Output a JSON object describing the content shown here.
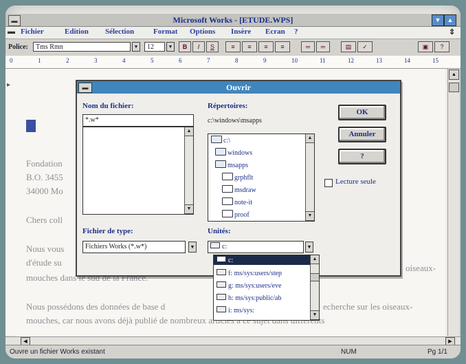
{
  "window": {
    "title": "Microsoft Works - [ETUDE.WPS]"
  },
  "menu": [
    "Fichier",
    "Edition",
    "Sélection",
    "Format",
    "Options",
    "Insère",
    "Ecran",
    "?"
  ],
  "toolbar": {
    "font_label": "Police:",
    "font_value": "Tms Rmn",
    "size_value": "12",
    "bold": "B",
    "italic": "I",
    "underline": "S"
  },
  "ruler": [
    "0",
    "1",
    "2",
    "3",
    "4",
    "5",
    "6",
    "7",
    "8",
    "9",
    "10",
    "11",
    "12",
    "13",
    "14",
    "15"
  ],
  "document": {
    "lines": [
      "Fondation",
      "B.O. 3455",
      "34000 Mo",
      "Chers coll",
      "Nous vous",
      "d'étude su",
      "mouches dans le sud de la France.",
      "Nous possédons des données de base d",
      "mouches, car nous avons déjà publié de nombreux articles à ce sujet dans différents"
    ],
    "right_fragments": [
      "oiseaux-",
      "echerche sur les oiseaux-"
    ]
  },
  "dialog": {
    "title": "Ouvrir",
    "filename_label": "Nom du fichier:",
    "filename_value": "*.w*",
    "dirs_label": "Répertoires:",
    "current_path": "c:\\windows\\msapps",
    "directories": [
      "c:\\",
      "windows",
      "msapps",
      "grphflt",
      "msdraw",
      "note-it",
      "proof"
    ],
    "filetype_label": "Fichier de type:",
    "filetype_value": "Fichiers Works (*.w*)",
    "drives_label": "Unités:",
    "drive_value": "c:",
    "drives": [
      "c:",
      "f: ms/sys:users/step",
      "g: ms/sys:users/eve",
      "h: ms/sys:public/ab",
      "i: ms/sys:"
    ],
    "ok": "OK",
    "cancel": "Annuler",
    "help": "?",
    "readonly": "Lecture seule"
  },
  "status": {
    "message": "Ouvre un fichier Works existant",
    "num": "NUM",
    "page": "Pg 1/1"
  }
}
